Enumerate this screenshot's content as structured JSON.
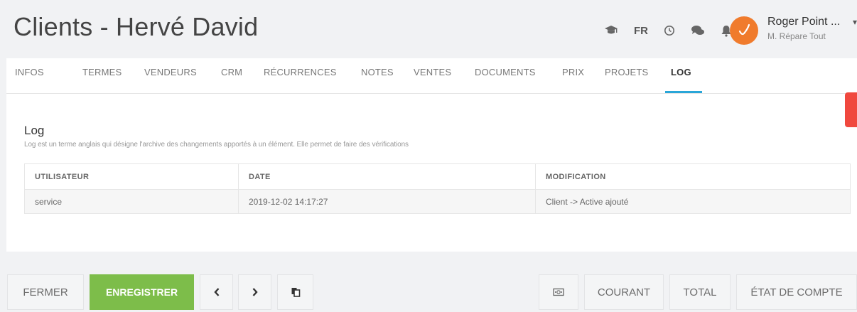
{
  "header": {
    "title": "Clients - Hervé David",
    "language": "FR",
    "icons": [
      "graduation-cap-icon",
      "clock-icon",
      "chat-icon",
      "bell-icon"
    ],
    "user": {
      "name": "Roger Point ...",
      "company": "M. Répare Tout"
    }
  },
  "tabs": [
    {
      "label": "INFOS"
    },
    {
      "label": "TERMES"
    },
    {
      "label": "VENDEURS"
    },
    {
      "label": "CRM"
    },
    {
      "label": "RÉCURRENCES"
    },
    {
      "label": "NOTES"
    },
    {
      "label": "VENTES"
    },
    {
      "label": "DOCUMENTS"
    },
    {
      "label": "PRIX"
    },
    {
      "label": "PROJETS"
    },
    {
      "label": "LOG",
      "active": true
    }
  ],
  "log": {
    "title": "Log",
    "description": "Log est un terme anglais qui désigne l'archive des changements apportés à un élément. Elle permet de faire des vérifications",
    "columns": [
      "UTILISATEUR",
      "DATE",
      "MODIFICATION"
    ],
    "rows": [
      {
        "user": "service",
        "date": "2019-12-02 14:17:27",
        "modification": "Client -> Active ajouté"
      }
    ]
  },
  "toolbar": {
    "close_label": "FERMER",
    "save_label": "ENREGISTRER",
    "current_label": "COURANT",
    "total_label": "TOTAL",
    "statement_label": "ÉTAT DE COMPTE"
  },
  "colors": {
    "accent_blue": "#2aa6d8",
    "save_green": "#7dbd4a",
    "avatar_orange": "#f07b2c",
    "alert_red": "#f0483e"
  }
}
